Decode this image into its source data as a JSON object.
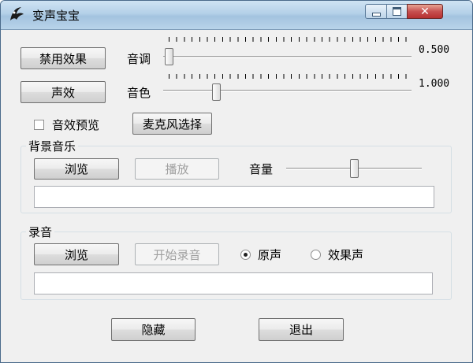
{
  "window": {
    "title": "变声宝宝",
    "icon": "app-logo-icon",
    "controls": [
      "minimize-icon",
      "maximize-icon",
      "close-icon"
    ],
    "close_glyph": "✕"
  },
  "effects": {
    "disable_button": "禁用效果",
    "sound_effect_button": "声效",
    "pitch_label": "音调",
    "pitch_value": "0.500",
    "pitch_level": 0.0,
    "timbre_label": "音色",
    "timbre_value": "1.000",
    "timbre_level": 0.2,
    "preview_checkbox_label": "音效预览",
    "preview_checked": false,
    "mic_select_button": "麦克风选择"
  },
  "background_music": {
    "title": "背景音乐",
    "browse_button": "浏览",
    "play_button": "播放",
    "volume_label": "音量",
    "volume_level": 0.5,
    "file_path": ""
  },
  "recording": {
    "title": "录音",
    "browse_button": "浏览",
    "start_button": "开始录音",
    "original_radio_label": "原声",
    "effect_radio_label": "效果声",
    "selected": "原声",
    "file_path": ""
  },
  "footer": {
    "hide_button": "隐藏",
    "exit_button": "退出"
  }
}
